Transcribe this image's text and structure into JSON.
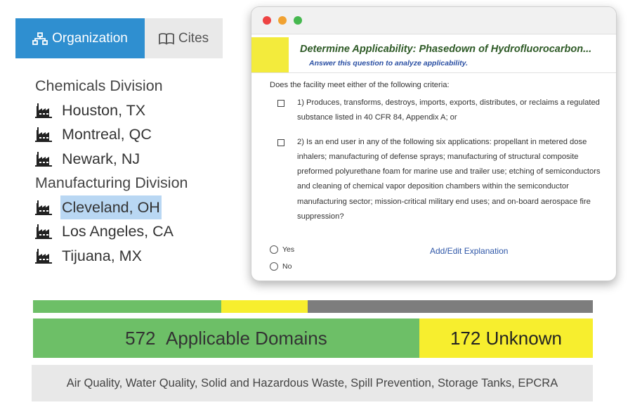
{
  "tabs": {
    "organization": {
      "label": "Organization",
      "icon": "org-chart-icon"
    },
    "cites": {
      "label": "Cites",
      "icon": "book-icon"
    }
  },
  "tree": {
    "divisions": [
      {
        "name": "Chemicals Division",
        "sites": [
          "Houston, TX",
          "Montreal, QC",
          "Newark, NJ"
        ]
      },
      {
        "name": "Manufacturing Division",
        "sites": [
          "Cleveland, OH",
          "Los Angeles, CA",
          "Tijuana, MX"
        ]
      }
    ],
    "selected_site": "Cleveland, OH",
    "site_icon": "factory-icon"
  },
  "dialog": {
    "title": "Determine Applicability: Phasedown of Hydrofluorocarbon...",
    "subtitle": "Answer this question to analyze applicability.",
    "question": "Does the facility meet either of the following criteria:",
    "criteria": [
      "1) Produces, transforms, destroys, imports, exports, distributes, or reclaims a regulated substance listed in 40 CFR 84, Appendix A; or",
      "2) Is an end user in any of the following six applications: propellant in metered dose inhalers; manufacturing of defense sprays; manufacturing of structural composite preformed polyurethane foam for marine use and trailer use; etching of semiconductors and cleaning of chemical vapor deposition chambers within the semiconductor manufacturing sector; mission-critical military end uses; and on-board aerospace fire suppression?"
    ],
    "options": [
      "Yes",
      "No"
    ],
    "add_explanation": "Add/Edit Explanation"
  },
  "progress": {
    "segments": [
      {
        "fraction": 0.336,
        "color": "#6dbf67"
      },
      {
        "fraction": 0.155,
        "color": "#f7ee2e"
      },
      {
        "fraction": 0.509,
        "color": "#7d7d7d"
      }
    ]
  },
  "domains": {
    "applicable": {
      "count": "572",
      "label": "Applicable Domains",
      "fraction": 0.69
    },
    "unknown": {
      "count": "172",
      "label": "Unknown",
      "fraction": 0.31
    },
    "list": "Air Quality, Water Quality, Solid and Hazardous Waste, Spill Prevention, Storage Tanks, EPCRA"
  }
}
